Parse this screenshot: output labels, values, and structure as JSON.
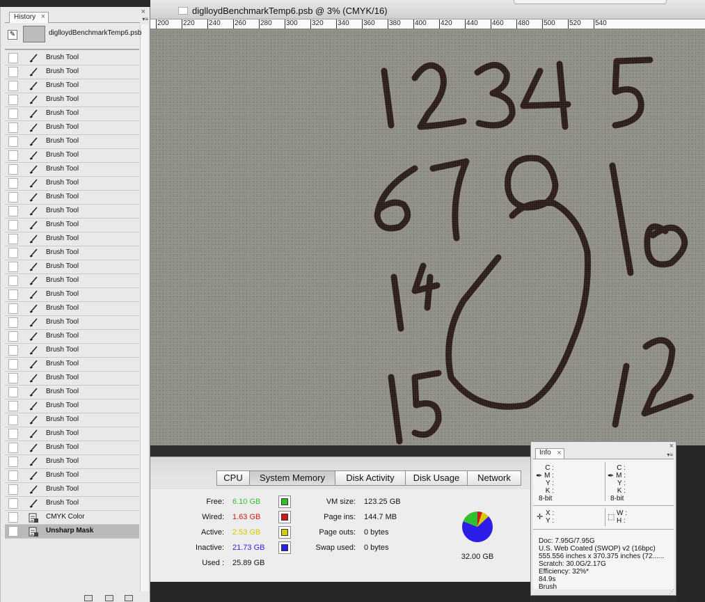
{
  "document": {
    "title": "diglloydBenchmarkTemp6.psb @ 3% (CMYK/16)",
    "ruler_ticks": [
      "200",
      "220",
      "240",
      "260",
      "280",
      "300",
      "320",
      "340",
      "360",
      "380",
      "400",
      "420",
      "440",
      "460",
      "480",
      "500",
      "520",
      "540"
    ]
  },
  "history_panel": {
    "tab_label": "History",
    "close_glyph": "×",
    "snapshot_label": "diglloydBenchmarkTemp6.psb",
    "items": [
      {
        "label": "Brush Tool",
        "icon": "brush-icon"
      },
      {
        "label": "Brush Tool",
        "icon": "brush-icon"
      },
      {
        "label": "Brush Tool",
        "icon": "brush-icon"
      },
      {
        "label": "Brush Tool",
        "icon": "brush-icon"
      },
      {
        "label": "Brush Tool",
        "icon": "brush-icon"
      },
      {
        "label": "Brush Tool",
        "icon": "brush-icon"
      },
      {
        "label": "Brush Tool",
        "icon": "brush-icon"
      },
      {
        "label": "Brush Tool",
        "icon": "brush-icon"
      },
      {
        "label": "Brush Tool",
        "icon": "brush-icon"
      },
      {
        "label": "Brush Tool",
        "icon": "brush-icon"
      },
      {
        "label": "Brush Tool",
        "icon": "brush-icon"
      },
      {
        "label": "Brush Tool",
        "icon": "brush-icon"
      },
      {
        "label": "Brush Tool",
        "icon": "brush-icon"
      },
      {
        "label": "Brush Tool",
        "icon": "brush-icon"
      },
      {
        "label": "Brush Tool",
        "icon": "brush-icon"
      },
      {
        "label": "Brush Tool",
        "icon": "brush-icon"
      },
      {
        "label": "Brush Tool",
        "icon": "brush-icon"
      },
      {
        "label": "Brush Tool",
        "icon": "brush-icon"
      },
      {
        "label": "Brush Tool",
        "icon": "brush-icon"
      },
      {
        "label": "Brush Tool",
        "icon": "brush-icon"
      },
      {
        "label": "Brush Tool",
        "icon": "brush-icon"
      },
      {
        "label": "Brush Tool",
        "icon": "brush-icon"
      },
      {
        "label": "Brush Tool",
        "icon": "brush-icon"
      },
      {
        "label": "Brush Tool",
        "icon": "brush-icon"
      },
      {
        "label": "Brush Tool",
        "icon": "brush-icon"
      },
      {
        "label": "Brush Tool",
        "icon": "brush-icon"
      },
      {
        "label": "Brush Tool",
        "icon": "brush-icon"
      },
      {
        "label": "Brush Tool",
        "icon": "brush-icon"
      },
      {
        "label": "Brush Tool",
        "icon": "brush-icon"
      },
      {
        "label": "Brush Tool",
        "icon": "brush-icon"
      },
      {
        "label": "Brush Tool",
        "icon": "brush-icon"
      },
      {
        "label": "Brush Tool",
        "icon": "brush-icon"
      },
      {
        "label": "Brush Tool",
        "icon": "brush-icon"
      },
      {
        "label": "CMYK Color",
        "icon": "adjustment-icon"
      },
      {
        "label": "Unsharp Mask",
        "icon": "filter-icon",
        "selected": true
      }
    ]
  },
  "activity_monitor": {
    "tabs": [
      "CPU",
      "System Memory",
      "Disk Activity",
      "Disk Usage",
      "Network"
    ],
    "active_tab": "System Memory",
    "memory": {
      "free": {
        "label": "Free:",
        "value": "6.10 GB",
        "color": "#2fbf2f"
      },
      "wired": {
        "label": "Wired:",
        "value": "1.63 GB",
        "color": "#d01818"
      },
      "active": {
        "label": "Active:",
        "value": "2.53 GB",
        "color": "#d8c800"
      },
      "inactive": {
        "label": "Inactive:",
        "value": "21.73 GB",
        "color": "#2c1ee8"
      },
      "used": {
        "label": "Used :",
        "value": "25.89 GB"
      }
    },
    "vm": {
      "vm_size": {
        "label": "VM size:",
        "value": "123.25 GB"
      },
      "page_ins": {
        "label": "Page ins:",
        "value": "144.7 MB"
      },
      "page_outs": {
        "label": "Page outs:",
        "value": "0 bytes"
      },
      "swap_used": {
        "label": "Swap used:",
        "value": "0 bytes"
      }
    },
    "pie_total": "32.00 GB",
    "pie_values_gb": {
      "free": 6.1,
      "wired": 1.63,
      "active": 2.53,
      "inactive": 21.73
    }
  },
  "info_panel": {
    "tab_label": "Info",
    "close_glyph": "×",
    "cmyk_left": [
      "C :",
      "M :",
      "Y :",
      "K :"
    ],
    "cmyk_right": [
      "C :",
      "M :",
      "Y :",
      "K :"
    ],
    "bitdepth_left": "8-bit",
    "bitdepth_right": "8-bit",
    "xy": [
      "X :",
      "Y :"
    ],
    "wh": [
      "W :",
      "H :"
    ],
    "lines": [
      "Doc: 7.95G/7.95G",
      "U.S. Web Coated (SWOP) v2 (16bpc)",
      "555.556 inches x 370.375 inches (72......",
      "Scratch: 30.0G/2.17G",
      "Efficiency: 32%*",
      "84.9s",
      "Brush"
    ]
  }
}
